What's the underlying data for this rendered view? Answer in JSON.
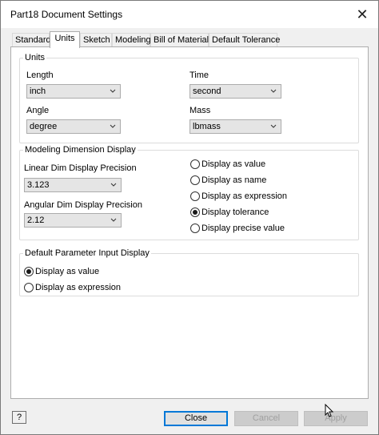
{
  "window": {
    "title": "Part18 Document Settings",
    "close_glyph": "✕"
  },
  "tabs": [
    {
      "label": "Standard",
      "active": false
    },
    {
      "label": "Units",
      "active": true
    },
    {
      "label": "Sketch",
      "active": false
    },
    {
      "label": "Modeling",
      "active": false
    },
    {
      "label": "Bill of Materials",
      "active": false
    },
    {
      "label": "Default Tolerance",
      "active": false
    }
  ],
  "units_group": {
    "title": "Units",
    "length": {
      "label": "Length",
      "value": "inch"
    },
    "time": {
      "label": "Time",
      "value": "second"
    },
    "angle": {
      "label": "Angle",
      "value": "degree"
    },
    "mass": {
      "label": "Mass",
      "value": "lbmass"
    }
  },
  "modeling_group": {
    "title": "Modeling Dimension Display",
    "linear": {
      "label": "Linear Dim Display Precision",
      "value": "3.123"
    },
    "angular": {
      "label": "Angular Dim Display Precision",
      "value": "2.12"
    },
    "options": [
      {
        "label": "Display as value",
        "checked": false
      },
      {
        "label": "Display as name",
        "checked": false
      },
      {
        "label": "Display as expression",
        "checked": false
      },
      {
        "label": "Display tolerance",
        "checked": true
      },
      {
        "label": "Display precise value",
        "checked": false
      }
    ]
  },
  "param_group": {
    "title": "Default Parameter Input Display",
    "options": [
      {
        "label": "Display as value",
        "checked": true
      },
      {
        "label": "Display as expression",
        "checked": false
      }
    ]
  },
  "footer": {
    "help_glyph": "?",
    "close_label": "Close",
    "cancel_label": "Cancel",
    "apply_label": "Apply"
  },
  "colors": {
    "default_button_border": "#0078d7",
    "panel_bg": "#ffffff",
    "window_bg": "#f0f0f0"
  }
}
